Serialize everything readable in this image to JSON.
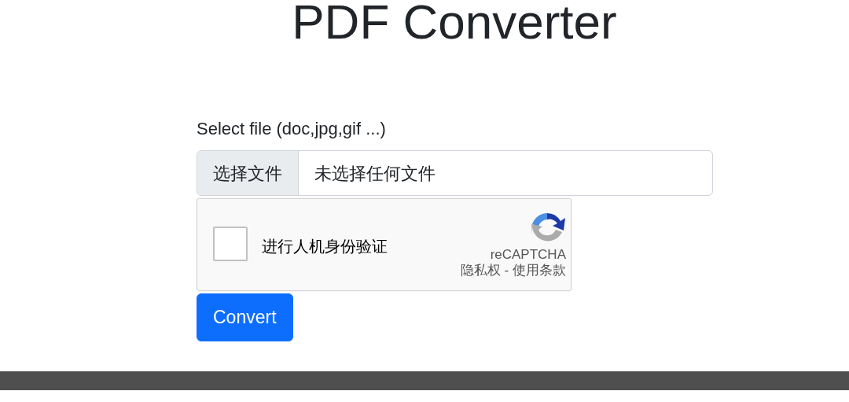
{
  "title": "PDF Converter",
  "form": {
    "label": "Select file (doc,jpg,gif ...)",
    "file_input": {
      "button": "选择文件",
      "value": "未选择任何文件"
    },
    "captcha": {
      "checked": false,
      "label": "进行人机身份验证",
      "brand": "reCAPTCHA",
      "privacy": "隐私权",
      "separator": "-",
      "terms": "使用条款"
    },
    "submit": "Convert"
  }
}
